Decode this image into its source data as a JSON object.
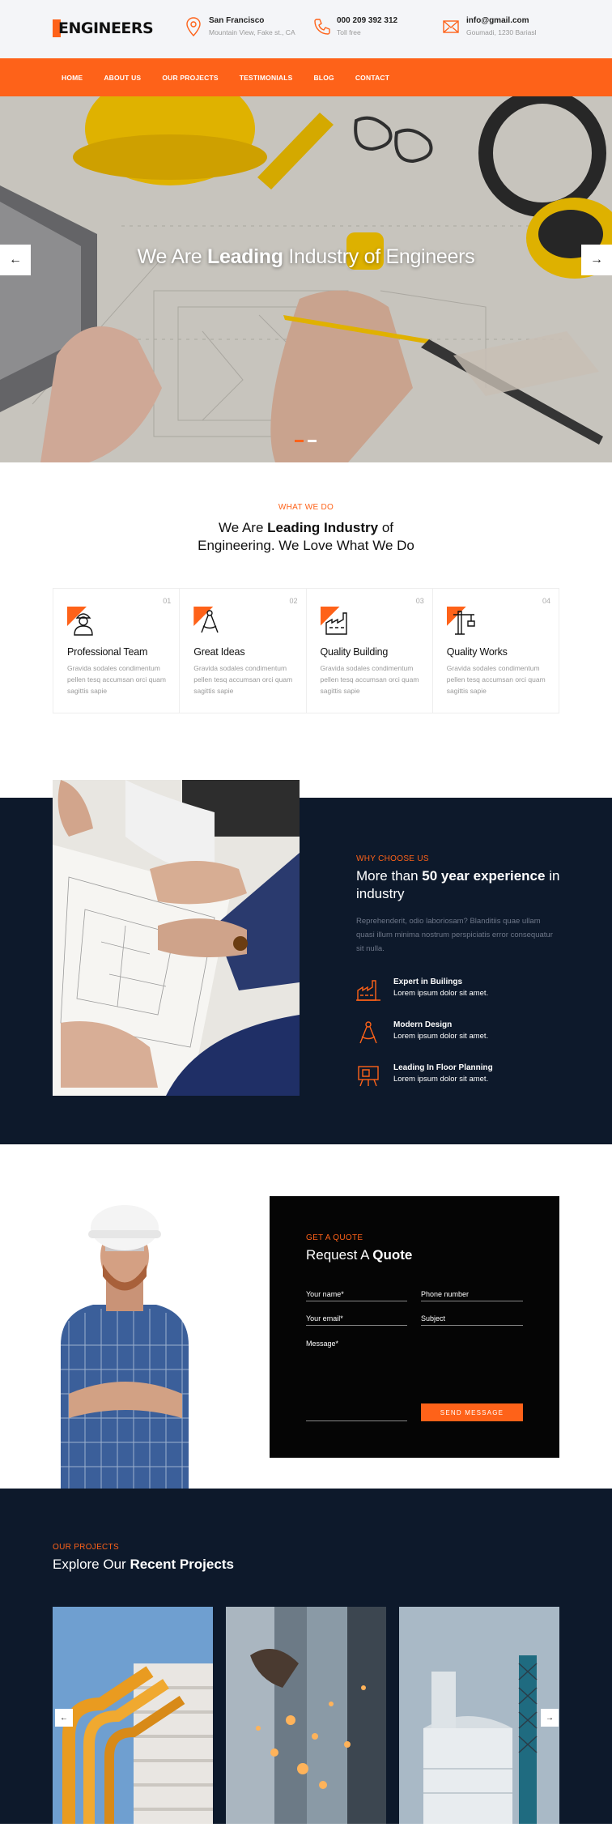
{
  "brand": {
    "name": "ENGINEERS",
    "accent": "#fe6219",
    "dark": "#0d192b"
  },
  "topbar": {
    "location": {
      "title": "San Francisco",
      "sub": "Mountain View, Fake st., CA",
      "icon": "map-pin-icon"
    },
    "phone": {
      "title": "000 209 392 312",
      "sub": "Toll free",
      "icon": "phone-icon"
    },
    "email": {
      "title": "info@gmail.com",
      "sub": "Goumadi, 1230 Bariasl",
      "icon": "mail-icon"
    }
  },
  "nav": {
    "items": [
      "HOME",
      "ABOUT US",
      "OUR PROJECTS",
      "TESTIMONIALS",
      "BLOG",
      "CONTACT"
    ]
  },
  "hero": {
    "title_pre": "We Are",
    "title_bold": "Leading",
    "title_post": "Industry of Engineers",
    "prev": "←",
    "next": "→"
  },
  "what": {
    "kicker": "WHAT WE DO",
    "h_pre": "We Are",
    "h_bold": "Leading Industry",
    "h_post": "of",
    "h_line2": "Engineering. We Love What We Do",
    "cards": [
      {
        "num": "01",
        "title": "Professional Team",
        "desc": "Gravida sodales condimentum pellen tesq accumsan orci quam sagittis sapie",
        "icon": "worker-icon"
      },
      {
        "num": "02",
        "title": "Great Ideas",
        "desc": "Gravida sodales condimentum pellen tesq accumsan orci quam sagittis sapie",
        "icon": "compass-icon"
      },
      {
        "num": "03",
        "title": "Quality Building",
        "desc": "Gravida sodales condimentum pellen tesq accumsan orci quam sagittis sapie",
        "icon": "factory-icon"
      },
      {
        "num": "04",
        "title": "Quality Works",
        "desc": "Gravida sodales condimentum pellen tesq accumsan orci quam sagittis sapie",
        "icon": "crane-icon"
      }
    ]
  },
  "why": {
    "kicker": "WHY CHOOSE US",
    "h_pre": "More than",
    "h_bold": "50 year experience",
    "h_post": "in industry",
    "para": "Reprehenderit, odio laboriosam? Blanditiis quae ullam quasi illum minima nostrum perspiciatis error consequatur sit nulla.",
    "features": [
      {
        "title": "Expert in Builings",
        "desc": "Lorem ipsum dolor sit amet.",
        "icon": "factory-icon"
      },
      {
        "title": "Modern Design",
        "desc": "Lorem ipsum dolor sit amet.",
        "icon": "compass-icon"
      },
      {
        "title": "Leading In Floor Planning",
        "desc": "Lorem ipsum dolor sit amet.",
        "icon": "blueprint-icon"
      }
    ]
  },
  "quote": {
    "kicker": "GET A QUOTE",
    "h_pre": "Request A",
    "h_bold": "Quote",
    "name_placeholder": "Your name*",
    "phone_placeholder": "Phone number",
    "email_placeholder": "Your email*",
    "subject_placeholder": "Subject",
    "message_placeholder": "Message*",
    "submit": "SEND MESSAGE"
  },
  "projects": {
    "kicker": "OUR PROJECTS",
    "h_pre": "Explore Our",
    "h_bold": "Recent Projects",
    "prev": "←",
    "next": "→"
  }
}
